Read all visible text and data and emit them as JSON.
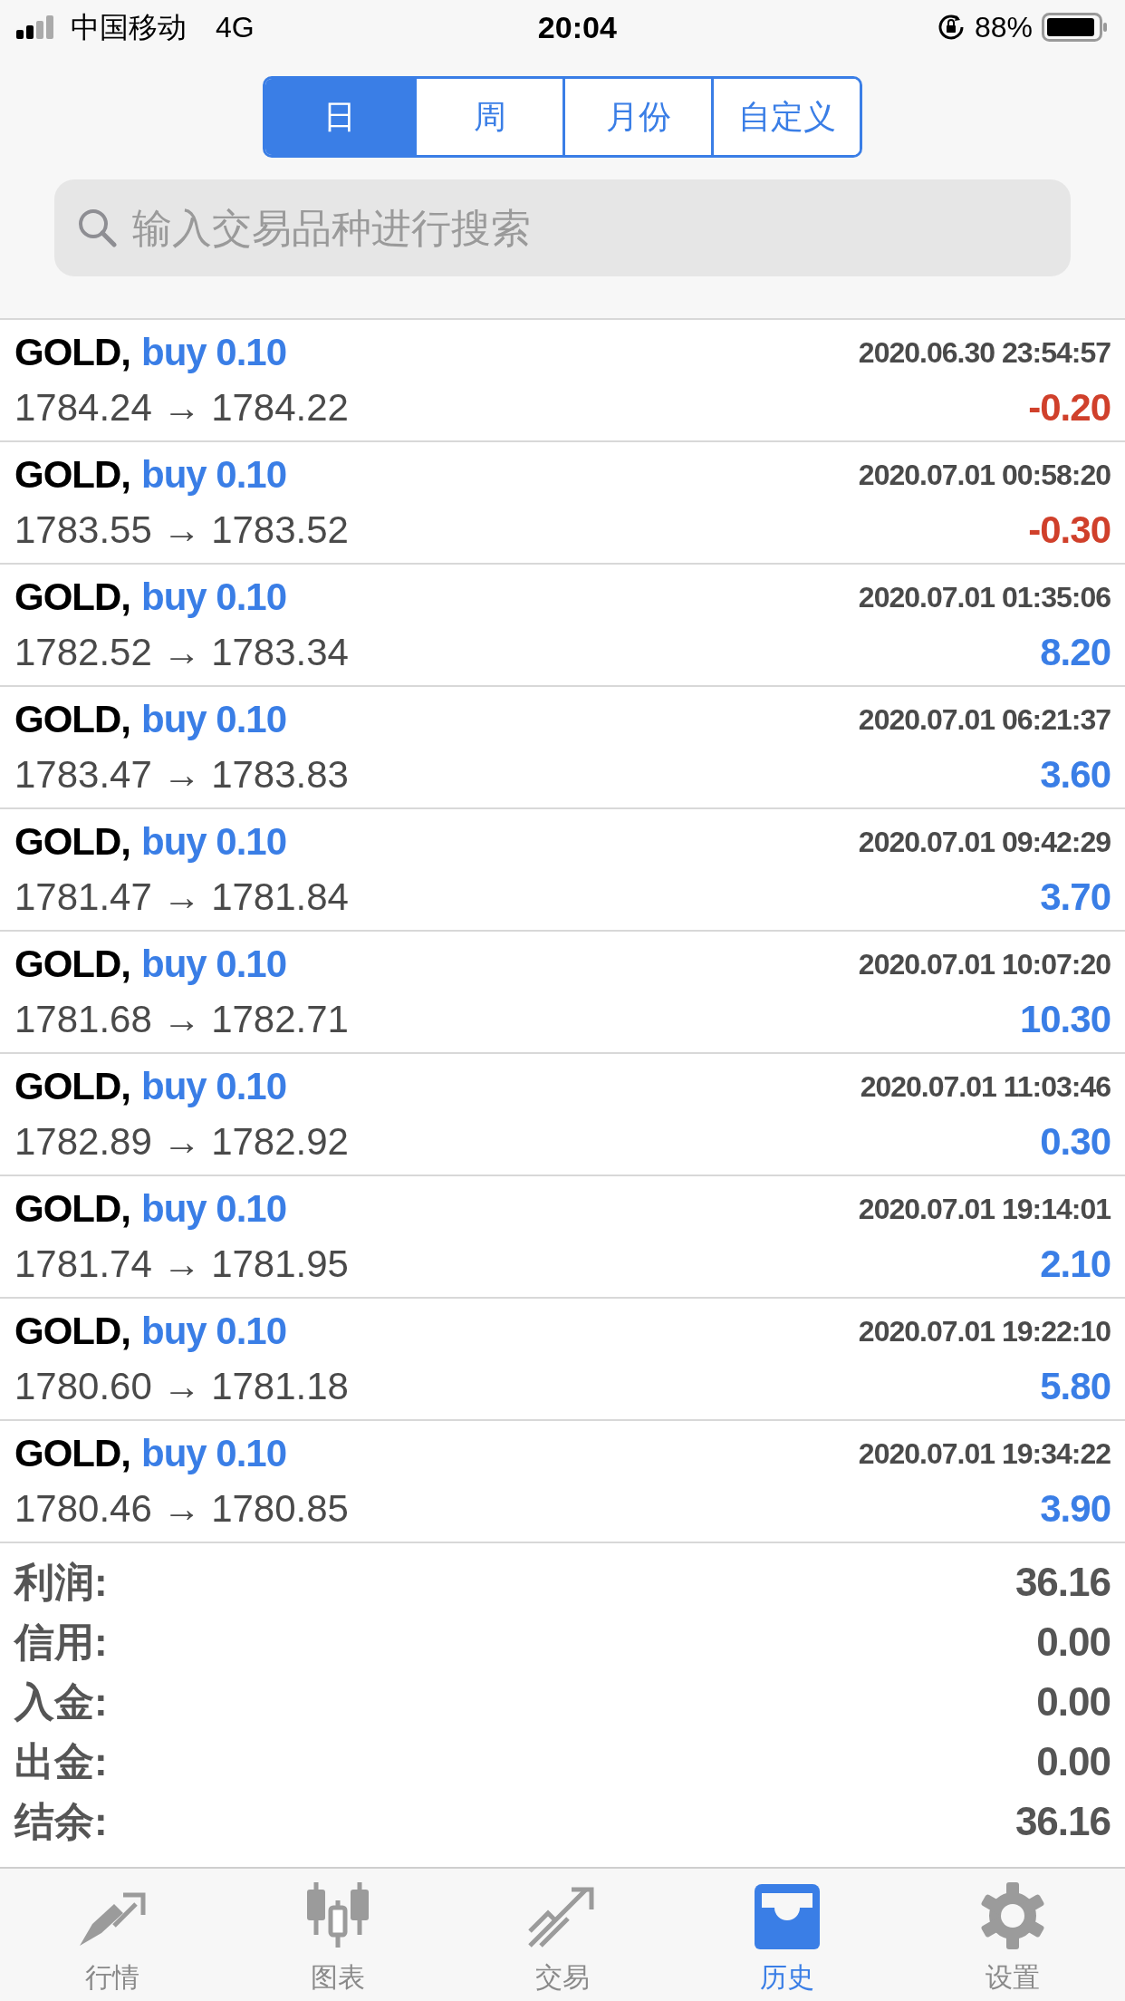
{
  "status_bar": {
    "carrier": "中国移动",
    "network": "4G",
    "time": "20:04",
    "battery": "88%"
  },
  "period_tabs": [
    {
      "label": "日",
      "selected": true
    },
    {
      "label": "周",
      "selected": false
    },
    {
      "label": "月份",
      "selected": false
    },
    {
      "label": "自定义",
      "selected": false
    }
  ],
  "search": {
    "placeholder": "输入交易品种进行搜索"
  },
  "deals": [
    {
      "symbol": "GOLD,",
      "side": "buy 0.10",
      "time": "2020.06.30 23:54:57",
      "prices": "1784.24 → 1784.22",
      "profit": "-0.20",
      "loss": true
    },
    {
      "symbol": "GOLD,",
      "side": "buy 0.10",
      "time": "2020.07.01 00:58:20",
      "prices": "1783.55 → 1783.52",
      "profit": "-0.30",
      "loss": true
    },
    {
      "symbol": "GOLD,",
      "side": "buy 0.10",
      "time": "2020.07.01 01:35:06",
      "prices": "1782.52 → 1783.34",
      "profit": "8.20",
      "loss": false
    },
    {
      "symbol": "GOLD,",
      "side": "buy 0.10",
      "time": "2020.07.01 06:21:37",
      "prices": "1783.47 → 1783.83",
      "profit": "3.60",
      "loss": false
    },
    {
      "symbol": "GOLD,",
      "side": "buy 0.10",
      "time": "2020.07.01 09:42:29",
      "prices": "1781.47 → 1781.84",
      "profit": "3.70",
      "loss": false
    },
    {
      "symbol": "GOLD,",
      "side": "buy 0.10",
      "time": "2020.07.01 10:07:20",
      "prices": "1781.68 → 1782.71",
      "profit": "10.30",
      "loss": false
    },
    {
      "symbol": "GOLD,",
      "side": "buy 0.10",
      "time": "2020.07.01 11:03:46",
      "prices": "1782.89 → 1782.92",
      "profit": "0.30",
      "loss": false
    },
    {
      "symbol": "GOLD,",
      "side": "buy 0.10",
      "time": "2020.07.01 19:14:01",
      "prices": "1781.74 → 1781.95",
      "profit": "2.10",
      "loss": false
    },
    {
      "symbol": "GOLD,",
      "side": "buy 0.10",
      "time": "2020.07.01 19:22:10",
      "prices": "1780.60 → 1781.18",
      "profit": "5.80",
      "loss": false
    },
    {
      "symbol": "GOLD,",
      "side": "buy 0.10",
      "time": "2020.07.01 19:34:22",
      "prices": "1780.46 → 1780.85",
      "profit": "3.90",
      "loss": false
    }
  ],
  "summary": [
    {
      "label": "利润:",
      "value": "36.16"
    },
    {
      "label": "信用:",
      "value": "0.00"
    },
    {
      "label": "入金:",
      "value": "0.00"
    },
    {
      "label": "出金:",
      "value": "0.00"
    },
    {
      "label": "结余:",
      "value": "36.16"
    }
  ],
  "tab_bar": [
    {
      "label": "行情",
      "kind": "quotes",
      "selected": false
    },
    {
      "label": "图表",
      "kind": "chart",
      "selected": false
    },
    {
      "label": "交易",
      "kind": "trade",
      "selected": false
    },
    {
      "label": "历史",
      "kind": "history",
      "selected": true
    },
    {
      "label": "设置",
      "kind": "settings",
      "selected": false
    }
  ]
}
